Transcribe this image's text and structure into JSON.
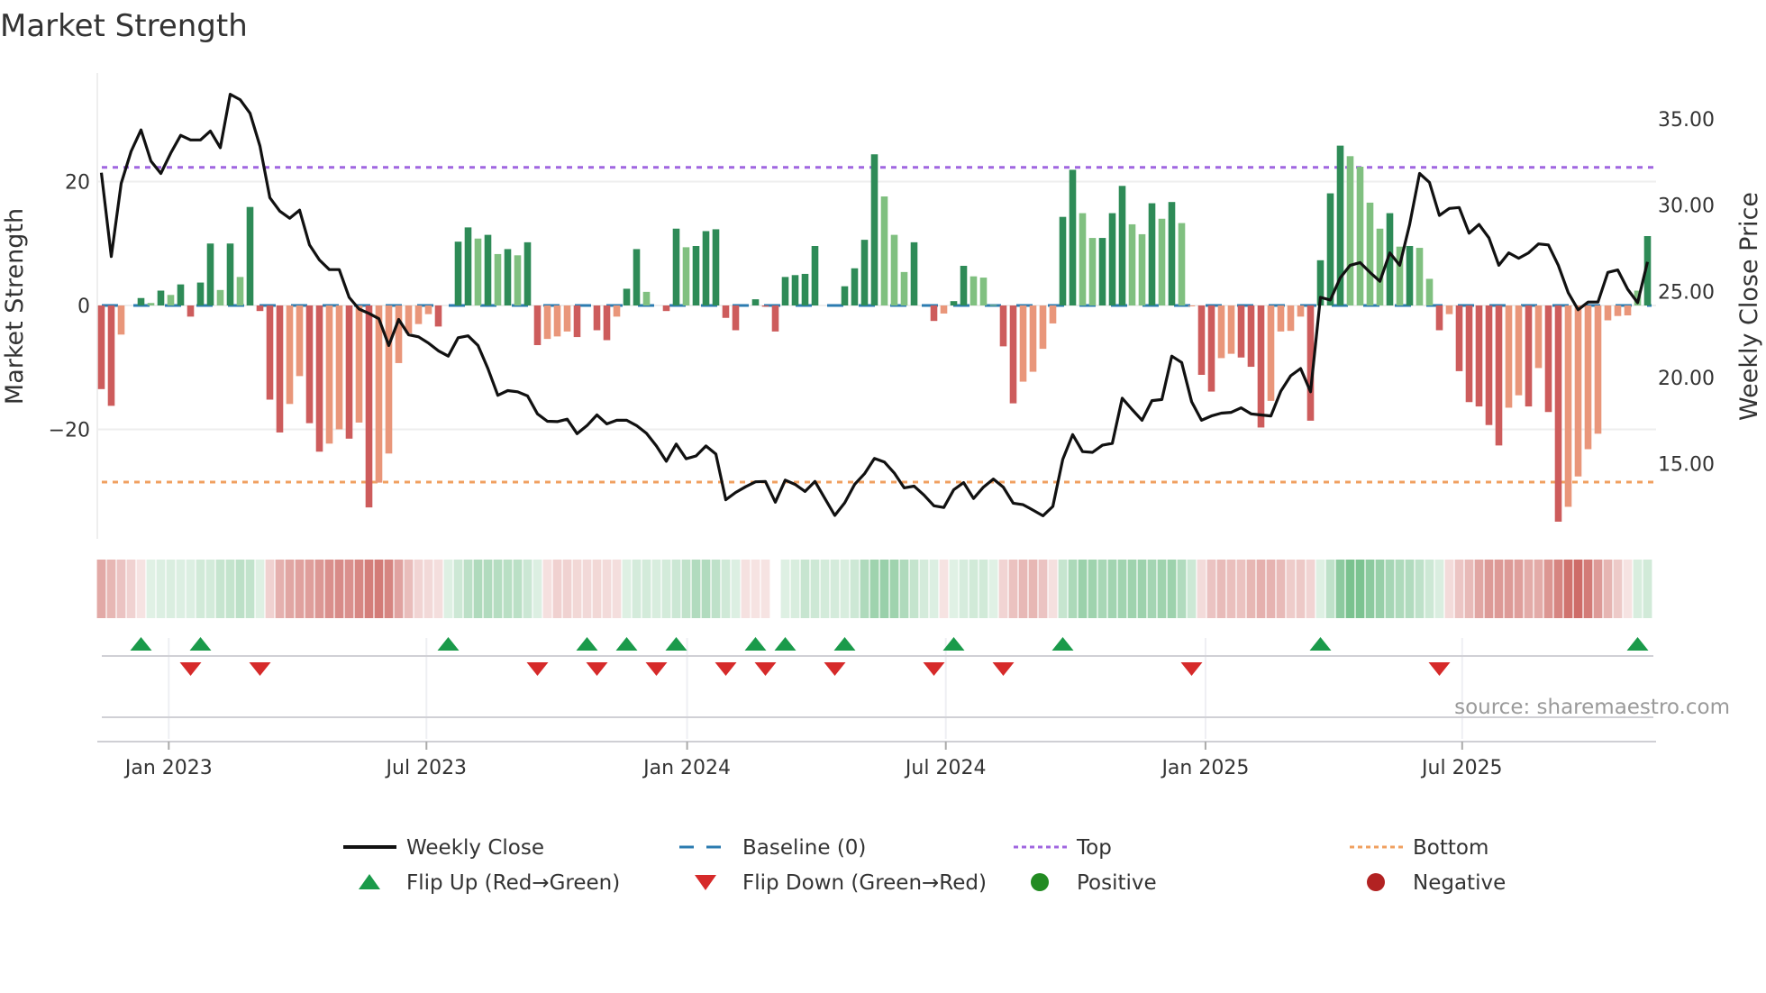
{
  "chart_data": {
    "type": "bar",
    "title": "Market Strength",
    "ylabel": "Market Strength",
    "y2label": "Weekly Close Price",
    "ylim": [
      -37.5,
      37.6
    ],
    "y2lim": [
      11.0,
      37.5
    ],
    "yticks": [
      {
        "value": 20,
        "label": "20"
      },
      {
        "value": 0,
        "label": "0"
      },
      {
        "value": -20,
        "label": "−20"
      }
    ],
    "y2ticks": [
      {
        "value": 35,
        "label": "35.00"
      },
      {
        "value": 30,
        "label": "30.00"
      },
      {
        "value": 25,
        "label": "25.00"
      },
      {
        "value": 20,
        "label": "20.00"
      },
      {
        "value": 15,
        "label": "15.00"
      }
    ],
    "x_unit": "week index",
    "xticks": [
      {
        "week": 6.8,
        "label": "Jan 2023"
      },
      {
        "week": 32.8,
        "label": "Jul 2023"
      },
      {
        "week": 59.1,
        "label": "Jan 2024"
      },
      {
        "week": 85.2,
        "label": "Jul 2024"
      },
      {
        "week": 111.4,
        "label": "Jan 2025"
      },
      {
        "week": 137.3,
        "label": "Jul 2025"
      }
    ],
    "top_level": 22.3,
    "bottom_level": -28.5,
    "baseline": 0,
    "strength": [
      -13.5,
      -16.2,
      -4.7,
      0,
      1.2,
      0.4,
      2.4,
      1.7,
      3.4,
      -1.8,
      3.7,
      10.0,
      2.5,
      10.0,
      4.6,
      15.9,
      -0.9,
      -15.2,
      -20.5,
      -15.9,
      -11.4,
      -19.0,
      -23.6,
      -22.3,
      -20.0,
      -21.5,
      -18.9,
      -32.6,
      -28.6,
      -23.9,
      -9.3,
      -4.5,
      -3.0,
      -1.4,
      -3.4,
      0,
      10.3,
      12.6,
      10.8,
      11.4,
      8.3,
      9.1,
      8.1,
      10.2,
      -6.4,
      -5.4,
      -5.0,
      -4.2,
      -5.1,
      0,
      -4.0,
      -5.6,
      -1.8,
      2.7,
      9.1,
      2.2,
      0,
      -0.9,
      12.4,
      9.4,
      9.6,
      12.0,
      12.3,
      -2.0,
      -4.0,
      0,
      1.0,
      -0.2,
      -4.2,
      4.6,
      4.9,
      5.1,
      9.6,
      0,
      0,
      3.1,
      6.0,
      10.6,
      24.4,
      17.6,
      11.4,
      5.4,
      10.2,
      0,
      -2.5,
      -1.3,
      0.7,
      6.4,
      4.7,
      4.5,
      0.1,
      -6.6,
      -15.8,
      -12.3,
      -10.7,
      -7.0,
      -2.9,
      14.3,
      21.9,
      14.9,
      10.9,
      10.9,
      14.9,
      19.3,
      13.1,
      11.5,
      16.5,
      14.0,
      16.7,
      13.3,
      -0.1,
      -11.2,
      -13.9,
      -8.5,
      -7.8,
      -8.4,
      -9.9,
      -19.7,
      -15.4,
      -4.2,
      -4.1,
      -1.8,
      -18.6,
      7.3,
      18.1,
      25.8,
      24.1,
      22.4,
      16.6,
      12.4,
      14.9,
      9.5,
      9.6,
      9.3,
      4.3,
      -4.0,
      -1.4,
      -10.6,
      -15.6,
      -16.3,
      -19.3,
      -22.6,
      -16.5,
      -14.5,
      -16.3,
      -10.1,
      -17.2,
      -34.9,
      -32.5,
      -27.6,
      -23.2,
      -20.7,
      -2.4,
      -1.7,
      -1.6,
      2.4,
      11.2
    ],
    "shade": [
      "d",
      "d",
      "l",
      "d",
      "d",
      "l",
      "d",
      "l",
      "d",
      "d",
      "d",
      "d",
      "l",
      "d",
      "l",
      "d",
      "d",
      "d",
      "d",
      "l",
      "l",
      "d",
      "d",
      "l",
      "l",
      "d",
      "l",
      "d",
      "l",
      "l",
      "l",
      "l",
      "l",
      "l",
      "d",
      "d",
      "d",
      "d",
      "l",
      "d",
      "l",
      "d",
      "l",
      "d",
      "d",
      "l",
      "l",
      "l",
      "d",
      "d",
      "d",
      "d",
      "l",
      "d",
      "d",
      "l",
      "d",
      "d",
      "d",
      "l",
      "d",
      "d",
      "d",
      "d",
      "d",
      "d",
      "d",
      "d",
      "d",
      "d",
      "d",
      "d",
      "d",
      "d",
      "d",
      "d",
      "d",
      "d",
      "d",
      "l",
      "l",
      "l",
      "d",
      "d",
      "d",
      "l",
      "d",
      "d",
      "l",
      "l",
      "l",
      "d",
      "d",
      "l",
      "l",
      "l",
      "l",
      "d",
      "d",
      "l",
      "l",
      "d",
      "d",
      "d",
      "l",
      "l",
      "d",
      "l",
      "d",
      "l",
      "l",
      "d",
      "d",
      "l",
      "l",
      "d",
      "d",
      "d",
      "l",
      "l",
      "l",
      "l",
      "d",
      "d",
      "d",
      "d",
      "l",
      "l",
      "l",
      "l",
      "d",
      "l",
      "d",
      "l",
      "l",
      "d",
      "l",
      "d",
      "d",
      "d",
      "d",
      "d",
      "l",
      "l",
      "d",
      "l",
      "d",
      "d",
      "l",
      "l",
      "l",
      "l",
      "l",
      "l",
      "l",
      "l",
      "d"
    ],
    "weekly_close": [
      31.88,
      27.02,
      31.26,
      33.12,
      34.36,
      32.56,
      31.84,
      33.02,
      34.05,
      33.78,
      33.78,
      34.3,
      33.33,
      36.43,
      36.12,
      35.33,
      33.43,
      30.43,
      29.65,
      29.24,
      29.71,
      27.69,
      26.82,
      26.26,
      26.26,
      24.65,
      23.97,
      23.72,
      23.41,
      21.86,
      23.37,
      22.48,
      22.36,
      22.0,
      21.55,
      21.24,
      22.31,
      22.42,
      21.86,
      20.52,
      18.97,
      19.24,
      19.17,
      18.93,
      17.89,
      17.46,
      17.44,
      17.58,
      16.74,
      17.21,
      17.83,
      17.31,
      17.52,
      17.52,
      17.21,
      16.76,
      16.03,
      15.14,
      16.14,
      15.29,
      15.45,
      16.03,
      15.56,
      12.91,
      13.33,
      13.66,
      13.95,
      13.97,
      12.77,
      14.05,
      13.8,
      13.39,
      13.97,
      12.98,
      12.0,
      12.73,
      13.8,
      14.42,
      15.31,
      15.1,
      14.46,
      13.6,
      13.7,
      13.18,
      12.56,
      12.46,
      13.49,
      13.9,
      12.98,
      13.64,
      14.11,
      13.64,
      12.71,
      12.62,
      12.31,
      11.98,
      12.52,
      15.25,
      16.69,
      15.7,
      15.66,
      16.07,
      16.18,
      18.8,
      18.14,
      17.52,
      18.66,
      18.72,
      21.24,
      20.87,
      18.6,
      17.52,
      17.77,
      17.93,
      17.98,
      18.24,
      17.89,
      17.83,
      17.77,
      19.21,
      20.1,
      20.52,
      19.17,
      24.65,
      24.5,
      25.79,
      26.51,
      26.67,
      26.1,
      25.58,
      27.23,
      26.51,
      28.88,
      31.84,
      31.32,
      29.4,
      29.81,
      29.86,
      28.37,
      28.88,
      28.1,
      26.51,
      27.23,
      26.92,
      27.23,
      27.75,
      27.69,
      26.51,
      24.92,
      23.93,
      24.38,
      24.38,
      26.1,
      26.24,
      25.12,
      24.34,
      26.71
    ],
    "flip_up_weeks": [
      4,
      10,
      35,
      49,
      53,
      58,
      66,
      69,
      75,
      86,
      97,
      123,
      155
    ],
    "flip_down_weeks": [
      9,
      16,
      44,
      50,
      56,
      63,
      67,
      74,
      84,
      91,
      110,
      135
    ],
    "legend_placement": "bottom-center",
    "legend": [
      {
        "label": "Weekly Close",
        "symbol": "line",
        "color": "#111111"
      },
      {
        "label": "Baseline (0)",
        "symbol": "dash",
        "color": "#2b7bb0"
      },
      {
        "label": "Top",
        "symbol": "dot",
        "color": "#a066e0"
      },
      {
        "label": "Bottom",
        "symbol": "dot",
        "color": "#f0a060"
      },
      {
        "label": "Flip Up (Red→Green)",
        "symbol": "triangle-up",
        "color": "#1a9a4a"
      },
      {
        "label": "Flip Down (Green→Red)",
        "symbol": "triangle-down",
        "color": "#d62a2a"
      },
      {
        "label": "Positive",
        "symbol": "circle",
        "color": "#228b22"
      },
      {
        "label": "Negative",
        "symbol": "circle",
        "color": "#b22222"
      }
    ],
    "colors": {
      "pos_dark": "#2e8b57",
      "pos_light": "#80c080",
      "neg_dark": "#cd5c5c",
      "neg_light": "#e9967a",
      "grid": "#eeeeee"
    },
    "source": "source: sharemaestro.com"
  }
}
